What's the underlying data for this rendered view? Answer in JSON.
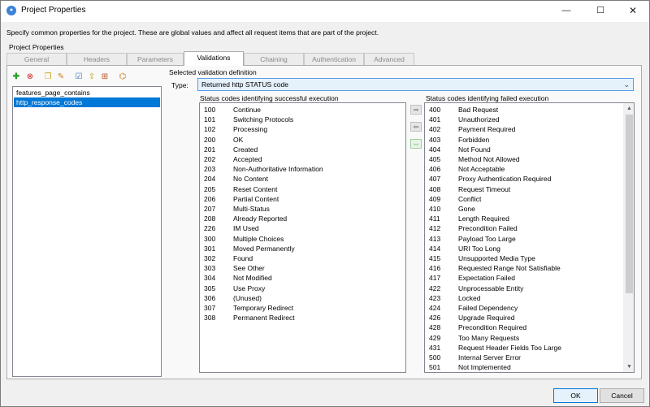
{
  "window": {
    "title": "Project Properties"
  },
  "description": "Specify common properties for the project. These are global values and affect all request items that are part of the project.",
  "group_label": "Project Properties",
  "tabs": [
    {
      "label": "General"
    },
    {
      "label": "Headers"
    },
    {
      "label": "Parameters"
    },
    {
      "label": "Validations"
    },
    {
      "label": "Chaining"
    },
    {
      "label": "Authentication"
    },
    {
      "label": "Advanced"
    }
  ],
  "active_tab": "Validations",
  "definitions": [
    {
      "label": "features_page_contains"
    },
    {
      "label": "http_response_codes"
    }
  ],
  "selected_definition_label": "Selected validation definition",
  "type": {
    "label": "Type:",
    "value": "Returned http STATUS code"
  },
  "successful": {
    "label": "Status codes identifying successful execution",
    "rows": [
      {
        "code": "100",
        "text": "Continue"
      },
      {
        "code": "101",
        "text": "Switching Protocols"
      },
      {
        "code": "102",
        "text": "Processing"
      },
      {
        "code": "200",
        "text": "OK"
      },
      {
        "code": "201",
        "text": "Created"
      },
      {
        "code": "202",
        "text": "Accepted"
      },
      {
        "code": "203",
        "text": "Non-Authoritative Information"
      },
      {
        "code": "204",
        "text": "No Content"
      },
      {
        "code": "205",
        "text": "Reset Content"
      },
      {
        "code": "206",
        "text": "Partial Content"
      },
      {
        "code": "207",
        "text": "Multi-Status"
      },
      {
        "code": "208",
        "text": "Already Reported"
      },
      {
        "code": "226",
        "text": "IM Used"
      },
      {
        "code": "300",
        "text": "Multiple Choices"
      },
      {
        "code": "301",
        "text": "Moved Permanently"
      },
      {
        "code": "302",
        "text": "Found"
      },
      {
        "code": "303",
        "text": "See Other"
      },
      {
        "code": "304",
        "text": "Not Modified"
      },
      {
        "code": "305",
        "text": "Use Proxy"
      },
      {
        "code": "306",
        "text": "(Unused)"
      },
      {
        "code": "307",
        "text": "Temporary Redirect"
      },
      {
        "code": "308",
        "text": "Permanent Redirect"
      }
    ]
  },
  "failed": {
    "label": "Status codes identifying failed execution",
    "rows": [
      {
        "code": "400",
        "text": "Bad Request"
      },
      {
        "code": "401",
        "text": "Unauthorized"
      },
      {
        "code": "402",
        "text": "Payment Required"
      },
      {
        "code": "403",
        "text": "Forbidden"
      },
      {
        "code": "404",
        "text": "Not Found"
      },
      {
        "code": "405",
        "text": "Method Not Allowed"
      },
      {
        "code": "406",
        "text": "Not Acceptable"
      },
      {
        "code": "407",
        "text": "Proxy Authentication Required"
      },
      {
        "code": "408",
        "text": "Request Timeout"
      },
      {
        "code": "409",
        "text": "Conflict"
      },
      {
        "code": "410",
        "text": "Gone"
      },
      {
        "code": "411",
        "text": "Length Required"
      },
      {
        "code": "412",
        "text": "Precondition Failed"
      },
      {
        "code": "413",
        "text": "Payload Too Large"
      },
      {
        "code": "414",
        "text": "URI Too Long"
      },
      {
        "code": "415",
        "text": "Unsupported Media Type"
      },
      {
        "code": "416",
        "text": "Requested Range Not Satisfiable"
      },
      {
        "code": "417",
        "text": "Expectation Failed"
      },
      {
        "code": "422",
        "text": "Unprocessable Entity"
      },
      {
        "code": "423",
        "text": "Locked"
      },
      {
        "code": "424",
        "text": "Failed Dependency"
      },
      {
        "code": "426",
        "text": "Upgrade Required"
      },
      {
        "code": "428",
        "text": "Precondition Required"
      },
      {
        "code": "429",
        "text": "Too Many Requests"
      },
      {
        "code": "431",
        "text": "Request Header Fields Too Large"
      },
      {
        "code": "500",
        "text": "Internal Server Error"
      },
      {
        "code": "501",
        "text": "Not Implemented"
      }
    ]
  },
  "buttons": {
    "ok": "OK",
    "cancel": "Cancel"
  },
  "icons": {
    "toolbar": [
      "add-icon",
      "delete-icon",
      "copy-icon",
      "edit-icon",
      "validate-icon",
      "export-icon",
      "import-icon",
      "settings-icon"
    ],
    "move": [
      "move-right-icon",
      "move-left-icon",
      "swap-icon"
    ]
  },
  "colors": {
    "selection": "#0078d7",
    "accent_green": "#2a9d2a"
  }
}
